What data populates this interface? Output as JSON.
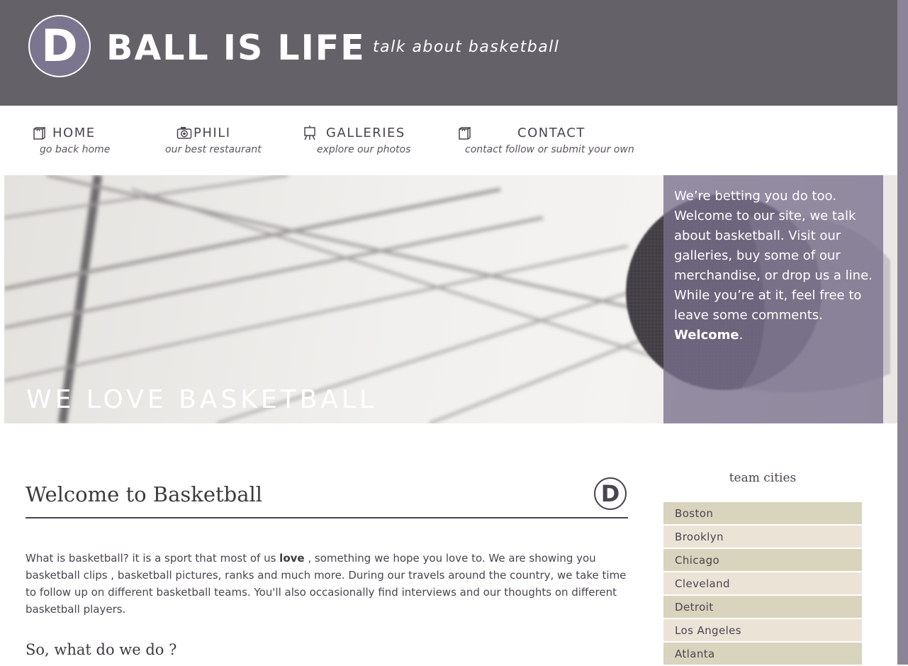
{
  "header": {
    "logo_letter": "D",
    "title": "BALL IS LIFE",
    "tagline": "talk about basketball"
  },
  "nav": [
    {
      "label": "HOME",
      "sub": "go back home",
      "icon": "shopping-bag-icon"
    },
    {
      "label": "PHILI",
      "sub": "our best restaurant",
      "icon": "camera-icon"
    },
    {
      "label": "GALLERIES",
      "sub": "explore our photos",
      "icon": "easel-icon"
    },
    {
      "label": "CONTACT",
      "sub": "contact follow or submit your own",
      "icon": "shopping-bag-icon"
    }
  ],
  "hero": {
    "heading": "WE LOVE BASKETBALL",
    "text": "We’re betting you do too. Welcome to our site, we talk about basketball. Visit our galleries, buy some of our merchandise, or drop us a line. While you’re at it, feel free to leave some comments.",
    "bold": "Welcome",
    "trail": "."
  },
  "main": {
    "title": "Welcome to Basketball",
    "logo_letter": "D",
    "intro_a": "What is basketball? it is a sport that most of us",
    "intro_bold": "love",
    "intro_b": ", something we hope you love to. We are showing you basketball clips , basketball pictures, ranks and much more. During our travels around the country, we take time to follow up on different basketball teams. You'll also occasionally find interviews and our thoughts on different basketball players.",
    "subheading": "So, what do we do ?"
  },
  "sidebar": {
    "title": "team cities",
    "cities": [
      "Boston",
      "Brooklyn",
      "Chicago",
      "Cleveland",
      "Detroit",
      "Los Angeles",
      "Atlanta"
    ]
  },
  "colors": {
    "header_bg": "#646169",
    "accent": "#7c7590",
    "city_odd": "#d8d4bd",
    "city_even": "#ece3d7"
  }
}
